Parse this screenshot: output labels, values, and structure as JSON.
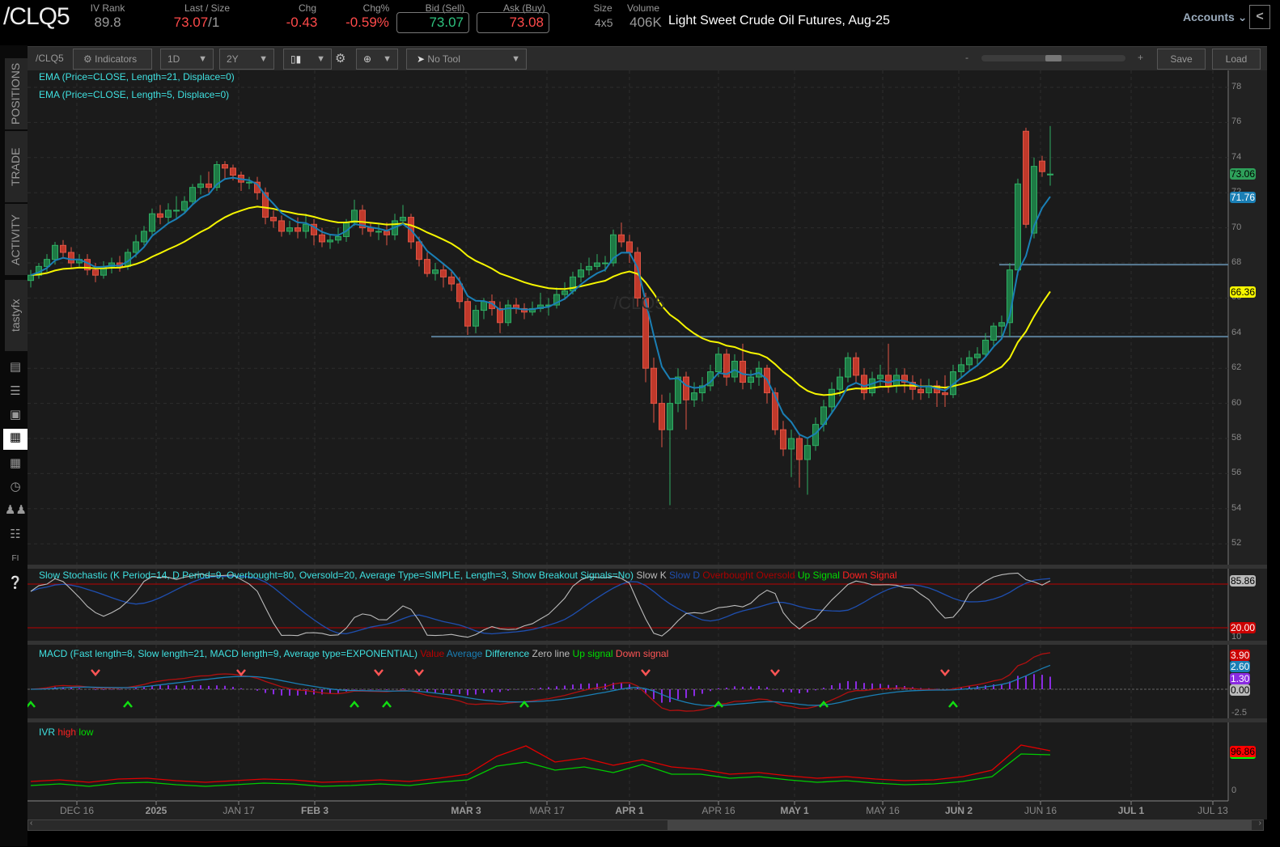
{
  "header": {
    "symbol": "/CLQ5",
    "iv_rank_label": "IV Rank",
    "iv_rank": "89.8",
    "last_label": "Last / Size",
    "last": "73.07",
    "size": "/1",
    "chg_label": "Chg",
    "chg": "-0.43",
    "chgpct_label": "Chg%",
    "chgpct": "-0.59%",
    "bid_label": "Bid (Sell)",
    "bid": "73.07",
    "ask_label": "Ask (Buy)",
    "ask": "73.08",
    "size_label": "Size",
    "size_value": "4x5",
    "volume_label": "Volume",
    "volume": "406K",
    "title": "Light Sweet Crude Oil Futures, Aug-25",
    "accounts": "Accounts",
    "collapse": "<"
  },
  "toolbar": {
    "symbol": "/CLQ5",
    "indicators": "Indicators",
    "interval": "1D",
    "range": "2Y",
    "tool": "No Tool",
    "zoom_minus": "-",
    "zoom_plus": "+",
    "zoom_level": 0.5,
    "save": "Save",
    "load": "Load"
  },
  "sidebar": {
    "tabs": [
      "POSITIONS",
      "TRADE",
      "ACTIVITY",
      "tastyfx"
    ]
  },
  "legends": {
    "ema21": "EMA (Price=CLOSE, Length=21, Displace=0)",
    "ema5": "EMA (Price=CLOSE, Length=5, Displace=0)",
    "stoch": "Slow Stochastic (K Period=14, D Period=9, Overbought=80, Oversold=20, Average Type=SIMPLE, Length=3, Show Breakout Signals=No)",
    "stoch_k": "Slow K",
    "stoch_d": "Slow D",
    "stoch_ob": "Overbought",
    "stoch_os": "Oversold",
    "stoch_up": "Up Signal",
    "stoch_down": "Down Signal",
    "macd": "MACD (Fast length=8, Slow length=21, MACD length=9, Average type=EXPONENTIAL)",
    "macd_value": "Value",
    "macd_avg": "Average",
    "macd_diff": "Difference",
    "macd_zero": "Zero line",
    "macd_up": "Up signal",
    "macd_down": "Down signal",
    "ivr": "IVR",
    "ivr_high": "high",
    "ivr_low": "low",
    "watermark": "/CLQ5"
  },
  "axis": {
    "price_ticks": [
      "78",
      "76",
      "74",
      "72",
      "70",
      "68",
      "66",
      "64",
      "62",
      "60",
      "58",
      "56",
      "54",
      "52"
    ],
    "tag_last": "73.06",
    "tag_ema5": "71.76",
    "tag_ema21": "66.36",
    "stoch_tag_k": "85.86",
    "stoch_tag_os": "20.00",
    "stoch_tick": "10",
    "macd_tags": [
      "3.90",
      "2.60",
      "1.30",
      "0.00"
    ],
    "macd_tick": "-2.5",
    "ivr_tag": "96.86",
    "ivr_tick": "0",
    "dates": [
      "DEC 16",
      "2025",
      "JAN 17",
      "FEB 3",
      "MAR 3",
      "MAR 17",
      "APR 1",
      "APR 16",
      "MAY 1",
      "MAY 16",
      "JUN 2",
      "JUN 16",
      "JUL 1",
      "JUL 13"
    ]
  },
  "colors": {
    "up": "#1e7a45",
    "down": "#c0392b",
    "ema21": "#f5f500",
    "ema5": "#1a7fb5",
    "slowk": "#bbbbbb",
    "slowd": "#1f4fb0",
    "macd_value": "#b01010",
    "macd_avg": "#1a7fb5",
    "hist": "#8a2be2"
  },
  "chart_data": {
    "type": "candlestick",
    "ylim": [
      51,
      79
    ],
    "hlines": [
      67.9,
      63.8
    ],
    "candles": [
      [
        67.0,
        67.6,
        66.6,
        67.3
      ],
      [
        67.3,
        68.0,
        67.1,
        67.8
      ],
      [
        67.8,
        68.5,
        67.5,
        68.2
      ],
      [
        68.2,
        69.2,
        67.9,
        69.0
      ],
      [
        69.0,
        69.3,
        68.3,
        68.6
      ],
      [
        68.6,
        68.9,
        67.7,
        68.0
      ],
      [
        68.0,
        68.5,
        67.8,
        68.2
      ],
      [
        68.2,
        68.5,
        67.3,
        67.6
      ],
      [
        67.6,
        68.0,
        66.9,
        67.3
      ],
      [
        67.3,
        68.1,
        67.1,
        67.8
      ],
      [
        67.8,
        68.3,
        67.4,
        68.0
      ],
      [
        68.0,
        68.4,
        67.5,
        67.8
      ],
      [
        67.8,
        68.8,
        67.6,
        68.6
      ],
      [
        68.6,
        69.6,
        68.3,
        69.2
      ],
      [
        69.2,
        70.1,
        69.0,
        69.8
      ],
      [
        69.8,
        71.1,
        69.6,
        70.8
      ],
      [
        70.8,
        71.3,
        70.2,
        70.6
      ],
      [
        70.6,
        71.4,
        70.3,
        71.0
      ],
      [
        71.0,
        71.8,
        70.5,
        71.0
      ],
      [
        71.0,
        71.8,
        70.8,
        71.5
      ],
      [
        71.5,
        72.5,
        71.3,
        72.3
      ],
      [
        72.3,
        73.0,
        71.9,
        72.5
      ],
      [
        72.5,
        73.2,
        72.0,
        72.3
      ],
      [
        72.3,
        73.8,
        72.1,
        73.6
      ],
      [
        73.6,
        73.8,
        72.8,
        73.4
      ],
      [
        73.4,
        73.6,
        72.7,
        73.0
      ],
      [
        73.0,
        73.2,
        72.1,
        72.6
      ],
      [
        72.6,
        72.9,
        72.2,
        72.6
      ],
      [
        72.6,
        72.9,
        71.6,
        72.0
      ],
      [
        72.0,
        72.3,
        70.2,
        70.6
      ],
      [
        70.6,
        71.0,
        70.0,
        70.4
      ],
      [
        70.4,
        70.7,
        69.5,
        69.8
      ],
      [
        69.8,
        70.4,
        69.6,
        70.0
      ],
      [
        70.0,
        70.6,
        69.4,
        69.8
      ],
      [
        69.8,
        70.8,
        69.4,
        70.2
      ],
      [
        70.2,
        70.5,
        69.0,
        69.6
      ],
      [
        69.6,
        70.0,
        68.9,
        69.2
      ],
      [
        69.2,
        69.6,
        68.8,
        69.3
      ],
      [
        69.3,
        70.0,
        69.1,
        69.5
      ],
      [
        69.5,
        70.5,
        69.2,
        70.3
      ],
      [
        70.3,
        71.6,
        70.1,
        71.0
      ],
      [
        71.0,
        71.3,
        69.6,
        70.0
      ],
      [
        70.0,
        70.3,
        69.5,
        69.8
      ],
      [
        69.8,
        70.2,
        69.3,
        69.8
      ],
      [
        69.8,
        70.3,
        69.0,
        69.6
      ],
      [
        69.6,
        70.8,
        69.3,
        70.4
      ],
      [
        70.4,
        71.3,
        70.2,
        70.6
      ],
      [
        70.6,
        70.8,
        68.8,
        69.2
      ],
      [
        69.2,
        69.5,
        67.8,
        68.2
      ],
      [
        68.2,
        68.6,
        67.2,
        67.4
      ],
      [
        67.4,
        68.0,
        67.0,
        67.6
      ],
      [
        67.6,
        67.9,
        66.6,
        67.2
      ],
      [
        67.2,
        67.5,
        66.4,
        66.8
      ],
      [
        66.8,
        67.2,
        65.4,
        65.8
      ],
      [
        65.8,
        66.0,
        63.9,
        64.4
      ],
      [
        64.4,
        65.6,
        64.0,
        65.3
      ],
      [
        65.3,
        66.0,
        64.8,
        65.8
      ],
      [
        65.8,
        66.2,
        65.0,
        65.4
      ],
      [
        65.4,
        65.8,
        64.0,
        64.6
      ],
      [
        64.6,
        65.9,
        64.4,
        65.6
      ],
      [
        65.6,
        66.0,
        65.1,
        65.4
      ],
      [
        65.4,
        65.7,
        64.8,
        65.2
      ],
      [
        65.2,
        65.8,
        65.0,
        65.4
      ],
      [
        65.4,
        66.3,
        65.2,
        65.6
      ],
      [
        65.6,
        66.0,
        65.0,
        65.6
      ],
      [
        65.6,
        66.6,
        65.4,
        66.2
      ],
      [
        66.2,
        66.9,
        65.9,
        66.4
      ],
      [
        66.4,
        67.5,
        66.2,
        67.2
      ],
      [
        67.2,
        68.0,
        66.9,
        67.6
      ],
      [
        67.6,
        68.3,
        67.3,
        67.8
      ],
      [
        67.8,
        68.5,
        67.6,
        68.0
      ],
      [
        68.0,
        68.4,
        67.5,
        68.0
      ],
      [
        68.0,
        69.9,
        67.8,
        69.6
      ],
      [
        69.6,
        70.3,
        68.9,
        69.2
      ],
      [
        69.2,
        69.6,
        68.0,
        68.6
      ],
      [
        68.6,
        68.9,
        65.5,
        66.0
      ],
      [
        66.0,
        66.3,
        61.2,
        62.0
      ],
      [
        62.0,
        62.6,
        58.9,
        60.0
      ],
      [
        60.0,
        60.5,
        57.5,
        58.5
      ],
      [
        58.5,
        60.6,
        54.2,
        60.0
      ],
      [
        60.0,
        62.0,
        59.5,
        61.5
      ],
      [
        61.5,
        61.8,
        58.5,
        60.2
      ],
      [
        60.2,
        61.2,
        59.8,
        60.6
      ],
      [
        60.6,
        61.5,
        60.1,
        61.0
      ],
      [
        61.0,
        62.2,
        60.7,
        61.8
      ],
      [
        61.8,
        63.2,
        61.5,
        62.8
      ],
      [
        62.8,
        63.1,
        61.0,
        61.5
      ],
      [
        61.5,
        62.8,
        61.2,
        62.4
      ],
      [
        62.4,
        63.4,
        60.8,
        61.2
      ],
      [
        61.2,
        61.9,
        60.8,
        61.5
      ],
      [
        61.5,
        62.4,
        61.0,
        62.0
      ],
      [
        62.0,
        62.2,
        60.0,
        60.6
      ],
      [
        60.6,
        60.9,
        58.2,
        58.5
      ],
      [
        58.5,
        59.0,
        57.0,
        57.4
      ],
      [
        57.4,
        58.5,
        55.8,
        58.0
      ],
      [
        58.0,
        58.3,
        55.2,
        56.8
      ],
      [
        56.8,
        58.0,
        54.8,
        57.6
      ],
      [
        57.6,
        59.2,
        57.3,
        58.8
      ],
      [
        58.8,
        60.2,
        58.4,
        59.8
      ],
      [
        59.8,
        61.2,
        59.5,
        60.8
      ],
      [
        60.8,
        62.0,
        60.4,
        61.5
      ],
      [
        61.5,
        62.9,
        61.2,
        62.6
      ],
      [
        62.6,
        62.9,
        61.2,
        61.6
      ],
      [
        61.6,
        62.0,
        60.2,
        60.6
      ],
      [
        60.6,
        61.8,
        60.4,
        61.4
      ],
      [
        61.4,
        62.2,
        61.0,
        61.6
      ],
      [
        61.6,
        63.4,
        60.6,
        61.0
      ],
      [
        61.0,
        62.0,
        60.6,
        61.6
      ],
      [
        61.6,
        62.0,
        60.6,
        61.2
      ],
      [
        61.2,
        61.6,
        60.2,
        60.8
      ],
      [
        60.8,
        61.4,
        60.2,
        60.6
      ],
      [
        60.6,
        61.4,
        60.3,
        61.0
      ],
      [
        61.0,
        61.3,
        59.8,
        60.6
      ],
      [
        60.6,
        61.6,
        59.8,
        60.5
      ],
      [
        60.5,
        62.2,
        60.3,
        61.8
      ],
      [
        61.8,
        62.6,
        61.5,
        62.2
      ],
      [
        62.2,
        63.0,
        61.9,
        62.6
      ],
      [
        62.6,
        63.2,
        62.2,
        62.8
      ],
      [
        62.8,
        64.0,
        62.6,
        63.6
      ],
      [
        63.6,
        64.6,
        63.3,
        64.4
      ],
      [
        64.4,
        65.0,
        63.8,
        64.6
      ],
      [
        64.6,
        68.0,
        63.8,
        67.6
      ],
      [
        67.6,
        72.8,
        67.3,
        72.5
      ],
      [
        75.5,
        75.7,
        70.0,
        70.2
      ],
      [
        69.7,
        74.0,
        69.4,
        73.5
      ],
      [
        73.8,
        74.1,
        72.9,
        73.2
      ],
      [
        73.06,
        75.8,
        72.4,
        73.06
      ]
    ],
    "macd_down_signals": [
      8,
      26,
      43,
      48,
      76,
      92,
      113
    ],
    "macd_up_signals": [
      0,
      12,
      40,
      44,
      61,
      85,
      98,
      114
    ],
    "ivr_high": [
      22,
      26,
      20,
      28,
      30,
      24,
      20,
      24,
      28,
      26,
      20,
      22,
      26,
      22,
      30,
      40,
      84,
      110,
      70,
      80,
      62,
      76,
      58,
      52,
      40,
      44,
      36,
      30,
      34,
      28,
      24,
      26,
      34,
      50,
      112,
      98
    ],
    "ivr_low": [
      12,
      16,
      10,
      18,
      20,
      14,
      10,
      14,
      18,
      16,
      10,
      12,
      16,
      12,
      20,
      26,
      60,
      70,
      50,
      58,
      44,
      64,
      40,
      40,
      30,
      34,
      26,
      20,
      24,
      18,
      14,
      16,
      22,
      34,
      90,
      88
    ]
  }
}
